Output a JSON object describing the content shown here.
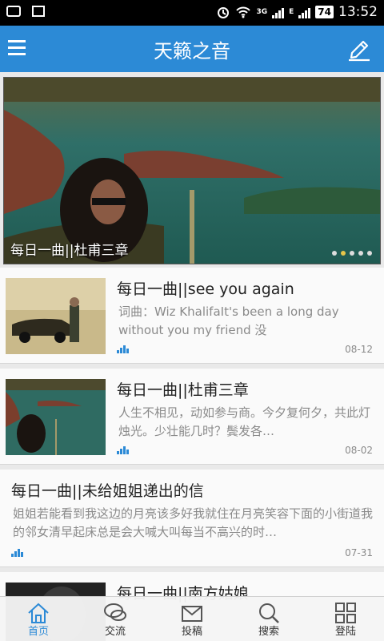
{
  "status_bar": {
    "network": "3G",
    "network2": "E",
    "battery": "74",
    "time": "13:52"
  },
  "header": {
    "title": "天籁之音",
    "left_icon": "menu-icon",
    "right_icon": "edit-icon"
  },
  "banner": {
    "caption": "每日一曲||杜甫三章",
    "dots_total": 5,
    "dots_active_index": 1
  },
  "articles": [
    {
      "title": "每日一曲||see you again",
      "summary": "词曲：Wiz KhalifaIt's been a long day without you my friend 没",
      "date": "08-12",
      "has_thumb": true
    },
    {
      "title": "每日一曲||杜甫三章",
      "summary": "人生不相见，动如参与商。今夕复何夕，共此灯烛光。少壮能几时？鬓发各…",
      "date": "08-02",
      "has_thumb": true
    },
    {
      "title": "每日一曲||未给姐姐递出的信",
      "summary": "姐姐若能看到我这边的月亮该多好我就住在月亮笑容下面的小街道我的邻女清早起床总是会大喊大叫每当不高兴的时…",
      "date": "07-31",
      "has_thumb": false
    },
    {
      "title": "每日一曲||南方姑娘",
      "summary": "",
      "date": "",
      "has_thumb": true
    }
  ],
  "bottom_nav": [
    {
      "label": "首页",
      "icon": "home-icon",
      "active": true
    },
    {
      "label": "交流",
      "icon": "chat-icon",
      "active": false
    },
    {
      "label": "投稿",
      "icon": "mail-icon",
      "active": false
    },
    {
      "label": "搜索",
      "icon": "search-icon",
      "active": false
    },
    {
      "label": "登陆",
      "icon": "grid-icon",
      "active": false
    }
  ],
  "colors": {
    "accent": "#2c8ad6",
    "background": "#e9e9e9"
  }
}
